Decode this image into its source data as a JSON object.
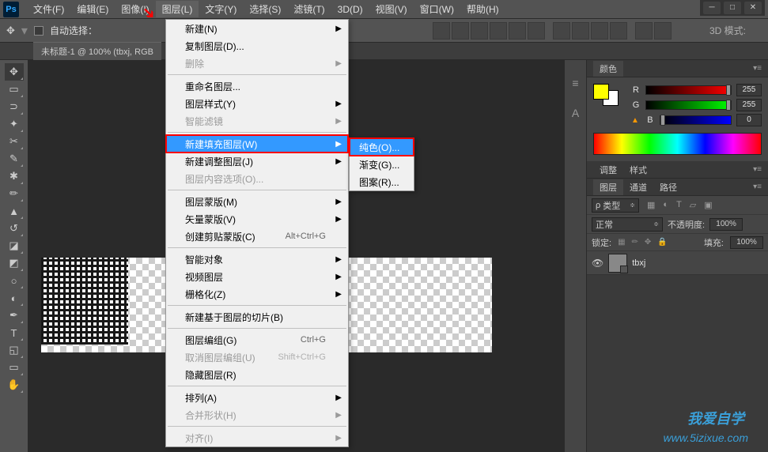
{
  "app_logo": "Ps",
  "menubar": {
    "items": [
      "文件(F)",
      "编辑(E)",
      "图像(I)",
      "图层(L)",
      "文字(Y)",
      "选择(S)",
      "滤镜(T)",
      "3D(D)",
      "视图(V)",
      "窗口(W)",
      "帮助(H)"
    ],
    "active_index": 3
  },
  "optionsbar": {
    "autoselect_label": "自动选择：",
    "mode3d_label": "3D 模式:"
  },
  "doctab": "未标题-1 @ 100% (tbxj, RGB",
  "layer_menu": {
    "items": [
      {
        "label": "新建(N)",
        "arrow": true
      },
      {
        "label": "复制图层(D)..."
      },
      {
        "label": "删除",
        "arrow": true,
        "disabled": true
      },
      {
        "sep": true
      },
      {
        "label": "重命名图层..."
      },
      {
        "label": "图层样式(Y)",
        "arrow": true
      },
      {
        "label": "智能滤镜",
        "arrow": true,
        "disabled": true
      },
      {
        "sep": true
      },
      {
        "label": "新建填充图层(W)",
        "arrow": true,
        "highlight": true,
        "redbox": true
      },
      {
        "label": "新建调整图层(J)",
        "arrow": true
      },
      {
        "label": "图层内容选项(O)...",
        "disabled": true
      },
      {
        "sep": true
      },
      {
        "label": "图层蒙版(M)",
        "arrow": true
      },
      {
        "label": "矢量蒙版(V)",
        "arrow": true
      },
      {
        "label": "创建剪贴蒙版(C)",
        "hotkey": "Alt+Ctrl+G"
      },
      {
        "sep": true
      },
      {
        "label": "智能对象",
        "arrow": true
      },
      {
        "label": "视频图层",
        "arrow": true
      },
      {
        "label": "栅格化(Z)",
        "arrow": true
      },
      {
        "sep": true
      },
      {
        "label": "新建基于图层的切片(B)"
      },
      {
        "sep": true
      },
      {
        "label": "图层编组(G)",
        "hotkey": "Ctrl+G"
      },
      {
        "label": "取消图层编组(U)",
        "hotkey": "Shift+Ctrl+G",
        "disabled": true
      },
      {
        "label": "隐藏图层(R)"
      },
      {
        "sep": true
      },
      {
        "label": "排列(A)",
        "arrow": true
      },
      {
        "label": "合并形状(H)",
        "arrow": true,
        "disabled": true
      },
      {
        "sep": true
      },
      {
        "label": "对齐(I)",
        "arrow": true,
        "disabled": true
      }
    ]
  },
  "submenu": {
    "items": [
      {
        "label": "纯色(O)...",
        "highlight": true,
        "redbox": true
      },
      {
        "label": "渐变(G)..."
      },
      {
        "label": "图案(R)..."
      }
    ]
  },
  "color_panel": {
    "tab": "颜色",
    "r_label": "R",
    "r_value": "255",
    "g_label": "G",
    "g_value": "255",
    "b_label": "B",
    "b_value": "0"
  },
  "adjust_panel": {
    "tab1": "调整",
    "tab2": "样式"
  },
  "layers_panel": {
    "tab1": "图层",
    "tab2": "通道",
    "tab3": "路径",
    "kind_label": "类型",
    "blend_mode": "正常",
    "opacity_label": "不透明度:",
    "opacity_value": "100%",
    "lock_label": "锁定:",
    "fill_label": "填充:",
    "fill_value": "100%",
    "layer_name": "tbxj"
  },
  "watermark": {
    "line1": "我爱自学",
    "line2": "www.5izixue.com"
  }
}
